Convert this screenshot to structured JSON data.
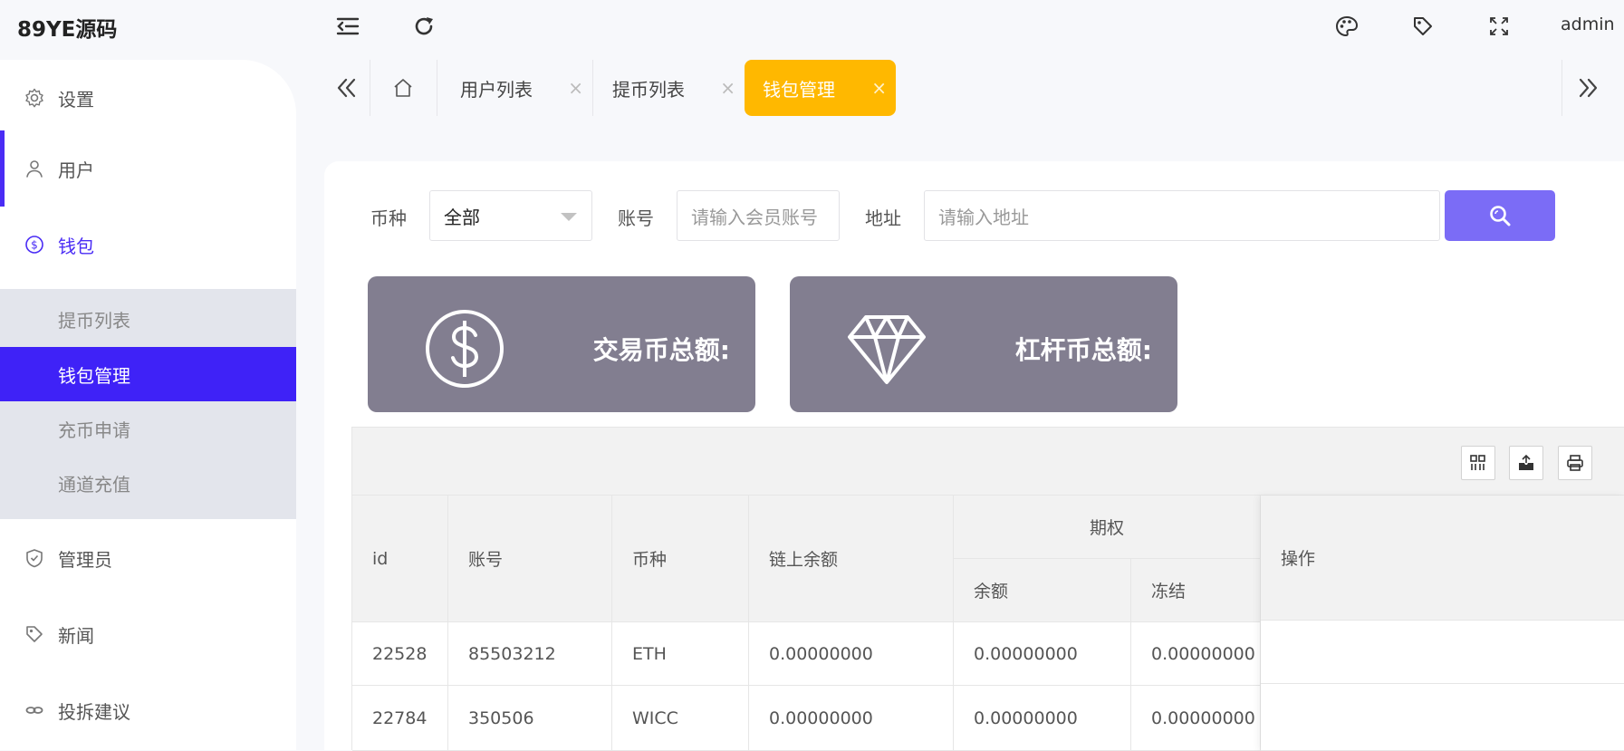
{
  "header": {
    "logo": "89YE源码",
    "user": "admin",
    "icons": [
      "menu-fold-icon",
      "refresh-icon",
      "theme-palette-icon",
      "tag-icon",
      "fullscreen-icon"
    ]
  },
  "sidebar": {
    "items": [
      {
        "label": "设置",
        "icon": "gear-icon"
      },
      {
        "label": "用户",
        "icon": "user-icon"
      },
      {
        "label": "钱包",
        "icon": "dollar-circle-icon"
      },
      {
        "label": "管理员",
        "icon": "shield-icon"
      },
      {
        "label": "新闻",
        "icon": "tag-icon"
      },
      {
        "label": "投拆建议",
        "icon": "link-icon"
      }
    ],
    "wallet_sub": [
      {
        "label": "提币列表"
      },
      {
        "label": "钱包管理"
      },
      {
        "label": "充币申请"
      },
      {
        "label": "通道充值"
      }
    ],
    "accent_color": "#4a2cf5"
  },
  "tabs": {
    "items": [
      {
        "label": "用户列表",
        "close": "×"
      },
      {
        "label": "提币列表",
        "close": "×"
      },
      {
        "label": "钱包管理",
        "close": "×"
      }
    ],
    "active_color": "#ffb800"
  },
  "filters": {
    "currency_label": "币种",
    "currency_value": "全部",
    "account_label": "账号",
    "account_placeholder": "请输入会员账号",
    "address_label": "地址",
    "address_placeholder": "请输入地址",
    "search_color": "#7b6cf6"
  },
  "stats": [
    {
      "label": "交易币总额:",
      "icon": "dollar-circle-icon"
    },
    {
      "label": "杠杆币总额:",
      "icon": "diamond-icon"
    }
  ],
  "table": {
    "toolbar_icons": [
      "columns-icon",
      "export-icon",
      "print-icon"
    ],
    "headers": {
      "id": "id",
      "account": "账号",
      "currency": "币种",
      "chain_balance": "链上余额",
      "group": "期权",
      "balance": "余额",
      "frozen": "冻结",
      "action": "操作"
    },
    "rows": [
      {
        "id": "22528",
        "account": "85503212",
        "currency": "ETH",
        "chain_balance": "0.00000000",
        "balance": "0.00000000",
        "frozen": "0.00000000"
      },
      {
        "id": "22784",
        "account": "350506",
        "currency": "WICC",
        "chain_balance": "0.00000000",
        "balance": "0.00000000",
        "frozen": "0.00000000"
      }
    ]
  }
}
